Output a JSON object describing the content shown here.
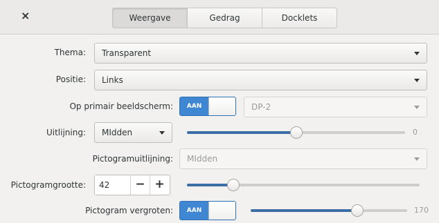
{
  "header": {
    "close_label": "×",
    "tabs": [
      {
        "label": "Weergave",
        "active": true
      },
      {
        "label": "Gedrag",
        "active": false
      },
      {
        "label": "Docklets",
        "active": false
      }
    ]
  },
  "settings": {
    "theme": {
      "label": "Thema:",
      "value": "Transparent"
    },
    "position": {
      "label": "Positie:",
      "value": "Links"
    },
    "primary_display": {
      "label": "Op primair beeldscherm:",
      "switch": "AAN",
      "value": "DP-2"
    },
    "alignment": {
      "label": "Uitlijning:",
      "value": "MIdden",
      "slider_value": "0",
      "slider_fraction": 0.5
    },
    "icon_alignment": {
      "label": "Pictogramuitlijning:",
      "value": "MIdden"
    },
    "icon_size": {
      "label": "Pictogramgrootte:",
      "value": "42",
      "minus": "−",
      "plus": "+",
      "slider_fraction": 0.2
    },
    "zoom": {
      "label": "Pictogram vergroten:",
      "switch": "AAN",
      "slider_value": "170",
      "slider_fraction": 0.68
    }
  },
  "colors": {
    "accent": "#3f86d3",
    "slider_fill": "#3a6ea5"
  }
}
